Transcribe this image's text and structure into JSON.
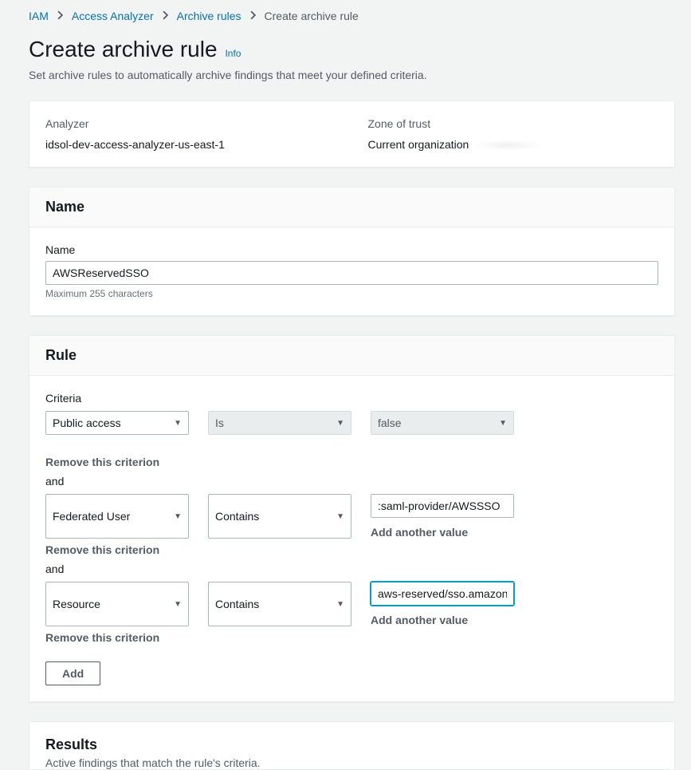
{
  "breadcrumb": {
    "iam": "IAM",
    "access_analyzer": "Access Analyzer",
    "archive_rules": "Archive rules",
    "current": "Create archive rule"
  },
  "page_title": "Create archive rule",
  "info_link": "Info",
  "subtitle": "Set archive rules to automatically archive findings that meet your defined criteria.",
  "analyzer_section": {
    "analyzer_label": "Analyzer",
    "analyzer_value": "idsol-dev-access-analyzer-us-east-1",
    "zone_label": "Zone of trust",
    "zone_value": "Current organization"
  },
  "name_section": {
    "header": "Name",
    "field_label": "Name",
    "value": "AWSReservedSSO",
    "hint": "Maximum 255 characters"
  },
  "rule_section": {
    "header": "Rule",
    "criteria_label": "Criteria",
    "and_label": "and",
    "remove_label": "Remove this criterion",
    "add_value_label": "Add another value",
    "add_button": "Add",
    "criteria": [
      {
        "property": "Public access",
        "operator": "Is",
        "value": "false",
        "operator_disabled": true,
        "value_is_select": true,
        "value_disabled": true,
        "show_add_value": false
      },
      {
        "property": "Federated User",
        "operator": "Contains",
        "value": ":saml-provider/AWSSSO",
        "operator_disabled": false,
        "value_is_select": false,
        "value_disabled": false,
        "show_add_value": true
      },
      {
        "property": "Resource",
        "operator": "Contains",
        "value": "aws-reserved/sso.amazonaw",
        "operator_disabled": false,
        "value_is_select": false,
        "value_disabled": false,
        "value_focused": true,
        "show_add_value": true
      }
    ]
  },
  "results_section": {
    "header": "Results",
    "subtitle": "Active findings that match the rule's criteria."
  }
}
